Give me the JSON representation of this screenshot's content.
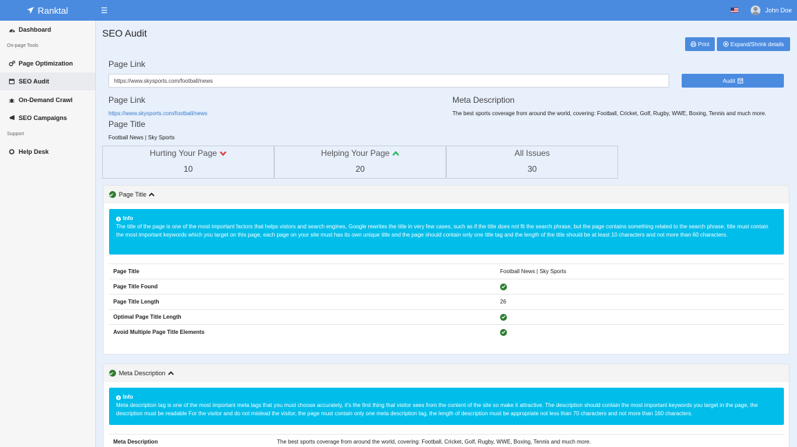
{
  "app": {
    "name": "Ranktal"
  },
  "user": {
    "name": "John Doe"
  },
  "sidebar": {
    "items": [
      {
        "label": "Dashboard"
      },
      {
        "label": "Page Optimization"
      },
      {
        "label": "SEO Audit"
      },
      {
        "label": "On-Demand Crawl"
      },
      {
        "label": "SEO Campaigns"
      },
      {
        "label": "Help Desk"
      }
    ],
    "sections": [
      "On-page Tools",
      "Support"
    ]
  },
  "page": {
    "title": "SEO Audit",
    "print_label": "Print",
    "expand_label": "Expand/Shrink details",
    "page_link_label": "Page Link",
    "url_value": "https://www.skysports.com/football/news",
    "audit_label": "Audit",
    "summary": {
      "page_link_label": "Page Link",
      "page_link": "https://www.skysports.com/football/news",
      "meta_description_label": "Meta Description",
      "meta_description": "The best sports coverage from around the world, covering: Football, Cricket, Golf, Rugby, WWE, Boxing, Tennis and much more.",
      "page_title_label": "Page Title",
      "page_title": "Football News | Sky Sports"
    },
    "stats": [
      {
        "label": "Hurting Your Page",
        "value": "10"
      },
      {
        "label": "Helping Your Page",
        "value": "20"
      },
      {
        "label": "All Issues",
        "value": "30"
      }
    ]
  },
  "sections": {
    "page_title": {
      "heading": "Page Title",
      "info_title": "Info",
      "info_text": "The title of the page is one of the most important factors that helps vistors and search engines, Google rewrites the title in very few cases, such as if the title does not fit the search phrase, but the page contains something related to the search phrase, title must contain the most important keywords which you target on this page, each page on your site must has its own unique title and the page should contain only one title tag and the length of the title should be at least 10 characters and not more than 60 characters.",
      "rows": [
        {
          "key": "Page Title",
          "value": "Football News | Sky Sports"
        },
        {
          "key": "Page Title Found",
          "value": ""
        },
        {
          "key": "Page Title Length",
          "value": "26"
        },
        {
          "key": "Optimal Page Title Length",
          "value": ""
        },
        {
          "key": "Avoid Multiple Page Title Elements",
          "value": ""
        }
      ]
    },
    "meta_description": {
      "heading": "Meta Description",
      "info_title": "Info",
      "info_text": "Meta description tag is one of the most important meta tags that you must choose accurately, it's the first thing that visitor sees from the content of the site so make it attractive. The description should contain the most important keywords you target in the page, the description must be readable For the visitor and do not mislead the visitor, the page must contain only one meta description tag, the length of description must be appropriate not less than 70 characters and not more than 160 characters.",
      "rows": [
        {
          "key": "Meta Description",
          "value": "The best sports coverage from around the world, covering: Football, Cricket, Golf, Rugby, WWE, Boxing, Tennis and much more."
        }
      ]
    }
  },
  "colors": {
    "primary": "#4a8be0",
    "info": "#00bdea",
    "success": "#2e7d32",
    "danger": "#e53935",
    "helping": "#1db954"
  }
}
